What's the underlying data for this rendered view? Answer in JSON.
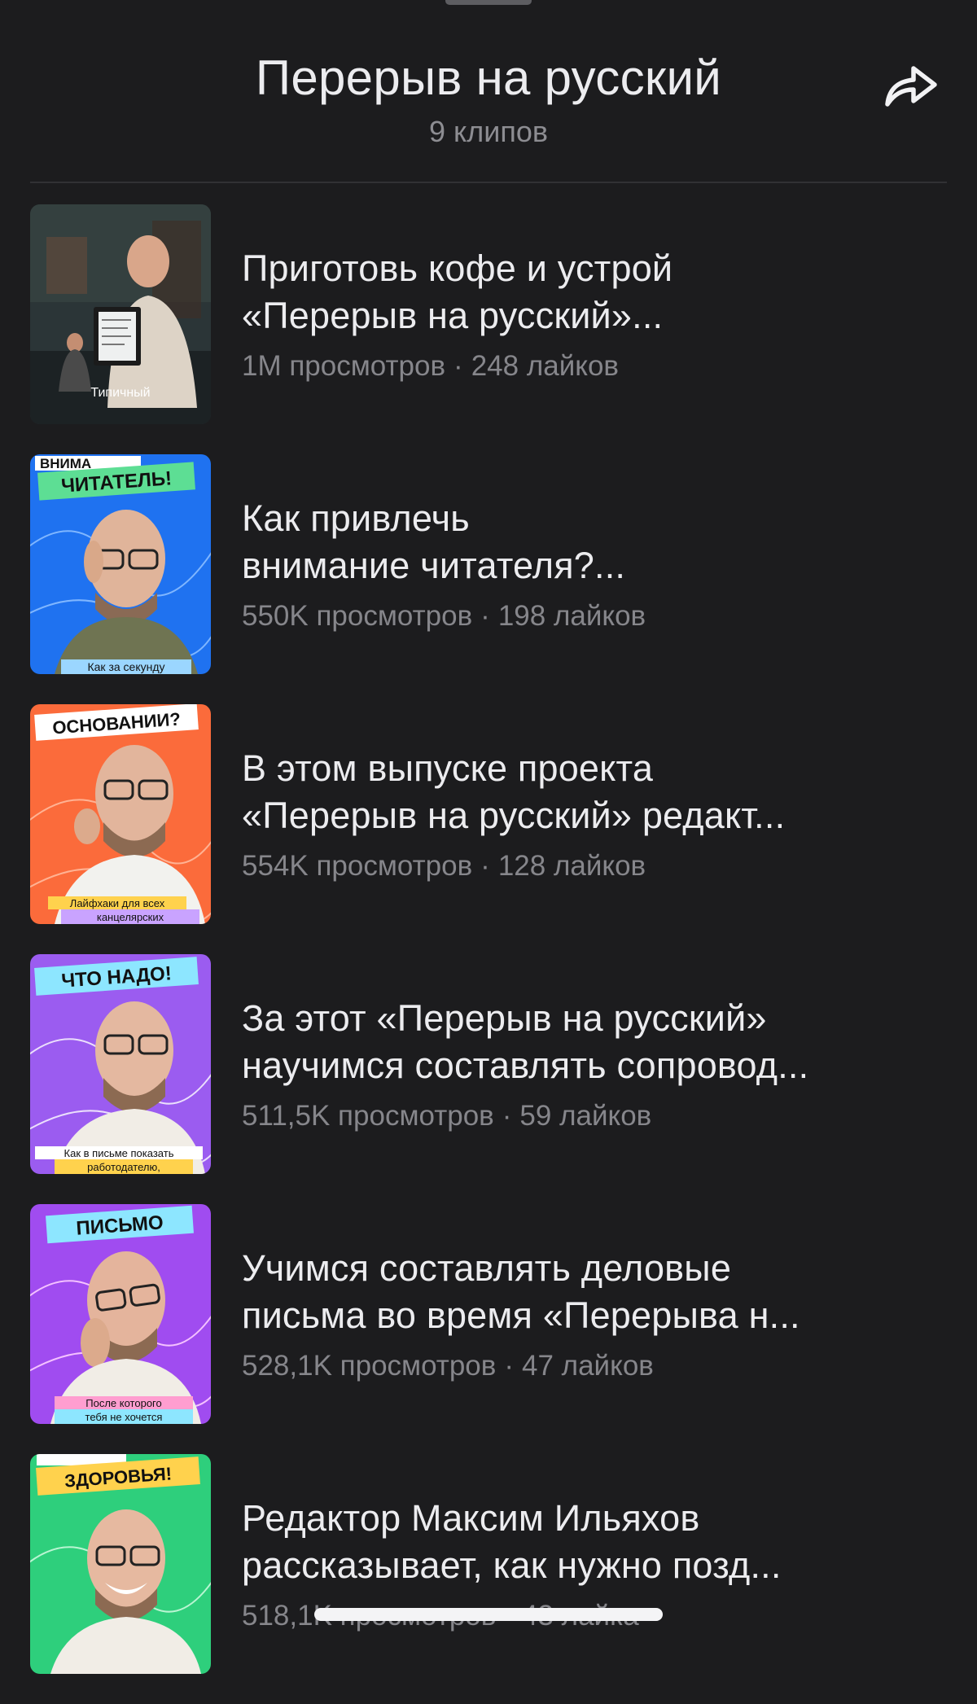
{
  "header": {
    "title": "Перерыв на русский",
    "subtitle": "9 клипов",
    "share_icon": "share-arrow-icon"
  },
  "clips": [
    {
      "title_line1": "Приготовь кофе и устрой",
      "title_line2": "«Перерыв на русский»...",
      "views": "1M просмотров",
      "likes": "248 лайков",
      "thumb_top_text": "",
      "thumb_top_text2": "",
      "thumb_bottom_text": "Типичный",
      "thumb_bottom_text2": "",
      "thumb_color": "#2e3b3d"
    },
    {
      "title_line1": "Как привлечь",
      "title_line2": "внимание читателя?...",
      "views": "550K просмотров",
      "likes": "198 лайков",
      "thumb_top_text": "ВНИМА",
      "thumb_top_text2": "ЧИТАТЕЛЬ!",
      "thumb_bottom_text": "Как за секунду",
      "thumb_bottom_text2": "",
      "thumb_color": "#1f72f0"
    },
    {
      "title_line1": "В этом выпуске проекта",
      "title_line2": "«Перерыв на русский» редакт...",
      "views": "554K просмотров",
      "likes": "128 лайков",
      "thumb_top_text": "",
      "thumb_top_text2": "ОСНОВАНИИ?",
      "thumb_bottom_text": "Лайфхаки для всех",
      "thumb_bottom_text2": "канцелярских",
      "thumb_color": "#fb6b3b"
    },
    {
      "title_line1": "За этот «Перерыв на русский»",
      "title_line2": "научимся составлять сопровод...",
      "views": "511,5K просмотров",
      "likes": "59 лайков",
      "thumb_top_text": "",
      "thumb_top_text2": "ЧТО НАДО!",
      "thumb_bottom_text": "Как в письме показать",
      "thumb_bottom_text2": "работодателю,",
      "thumb_color": "#9b5cf0"
    },
    {
      "title_line1": "Учимся составлять деловые",
      "title_line2": "письма во время «Перерыва н...",
      "views": "528,1K просмотров",
      "likes": "47 лайков",
      "thumb_top_text": "",
      "thumb_top_text2": "ПИСЬМО",
      "thumb_bottom_text": "После которого",
      "thumb_bottom_text2": "тебя не хочется",
      "thumb_color": "#a04cf0"
    },
    {
      "title_line1": "Редактор Максим Ильяхов",
      "title_line2": "рассказывает, как нужно позд...",
      "views": "518,1K просмотров",
      "likes": "43 лайка",
      "thumb_top_text": "",
      "thumb_top_text2": "ЗДОРОВЬЯ!",
      "thumb_bottom_text": "",
      "thumb_bottom_text2": "",
      "thumb_color": "#2ecf7c"
    }
  ]
}
